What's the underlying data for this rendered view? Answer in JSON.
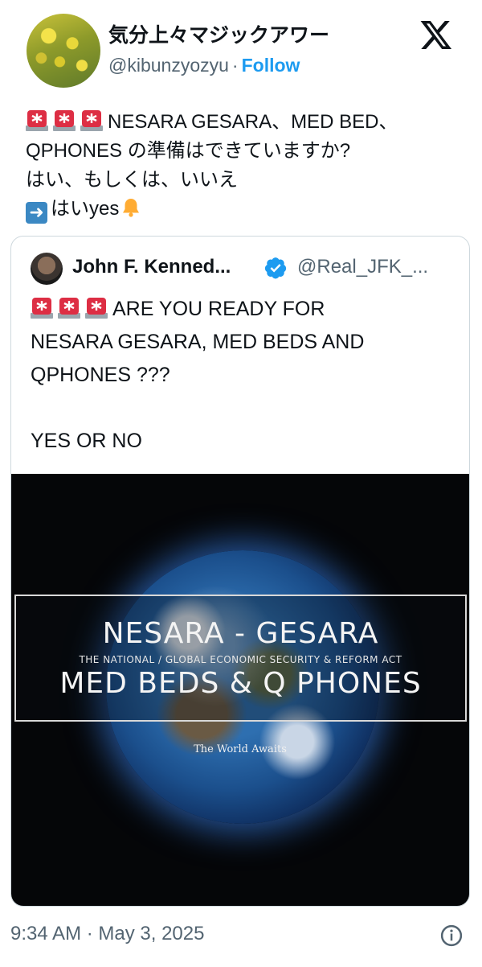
{
  "author": {
    "display_name": "気分上々マジックアワー",
    "handle": "@kibunzyozyu",
    "separator": "·",
    "follow_label": "Follow"
  },
  "tweet": {
    "line1": "NESARA GESARA、MED BED、",
    "line2": "QPHONES の準備はできていますか?",
    "line3": "はい、もしくは、いいえ",
    "line4": "はいyes"
  },
  "quoted_tweet": {
    "display_name": "John F. Kenned...",
    "handle": "@Real_JFK_...",
    "line1": "ARE YOU READY FOR",
    "line2": "NESARA GESARA, MED BEDS AND",
    "line3": "QPHONES ???",
    "line4": "",
    "line5": "YES OR NO",
    "media": {
      "title": "NESARA - GESARA",
      "subtitle": "THE NATIONAL / GLOBAL ECONOMIC SECURITY & REFORM ACT",
      "title2": "MED BEDS & Q PHONES",
      "tagline": "The World Awaits"
    }
  },
  "timestamp": "9:34 AM · May 3, 2025",
  "icons": [
    "x-logo-icon",
    "siren-icon",
    "arrow-right-icon",
    "bell-icon",
    "verified-badge-icon",
    "info-icon"
  ],
  "colors": {
    "link": "#1d9bf0",
    "muted": "#536471",
    "text": "#0f1419"
  }
}
